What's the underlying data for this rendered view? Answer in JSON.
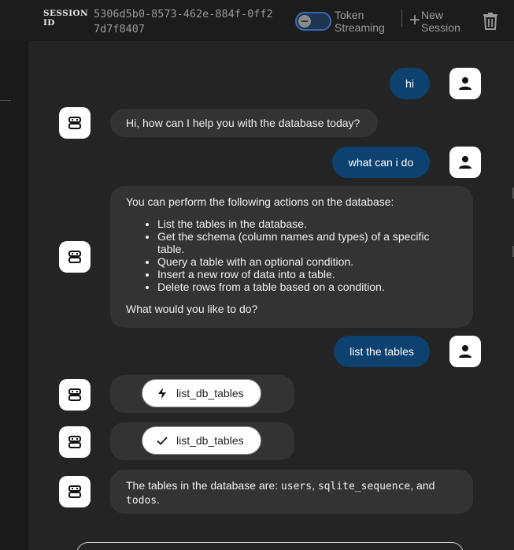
{
  "header": {
    "session_label": "SESSION ID",
    "session_id": "5306d5b0-8573-462e-884f-0ff27d7f8407",
    "toggle_label": "Token Streaming",
    "toggle_on": false,
    "new_session_label": "New Session",
    "icons": {
      "new_session": "plus-icon",
      "delete": "trash-icon",
      "toggle": "toggle-switch"
    }
  },
  "messages": [
    {
      "role": "user",
      "text": "hi"
    },
    {
      "role": "assistant",
      "text": "Hi, how can I help you with the database today?"
    },
    {
      "role": "user",
      "text": "what can i do"
    },
    {
      "role": "assistant",
      "intro": "You can perform the following actions on the database:",
      "items": [
        "List the tables in the database.",
        "Get the schema (column names and types) of a specific table.",
        "Query a table with an optional condition.",
        "Insert a new row of data into a table.",
        "Delete rows from a table based on a condition."
      ],
      "outro": "What would you like to do?"
    },
    {
      "role": "user",
      "text": "list the tables"
    },
    {
      "role": "tool",
      "status": "running",
      "status_icon": "lightning-icon",
      "tool_name": "list_db_tables"
    },
    {
      "role": "tool",
      "status": "done",
      "status_icon": "check-icon",
      "tool_name": "list_db_tables"
    },
    {
      "role": "assistant",
      "prefix": "The tables in the database are: ",
      "t1": "users",
      "sep1": ", ",
      "t2": "sqlite_sequence",
      "sep2": ", and ",
      "t3": "todos",
      "suffix": "."
    }
  ],
  "colors": {
    "user_bubble": "#0d4270",
    "assistant_bubble": "#333333",
    "panel": "#242424",
    "background": "#1c1c1c"
  }
}
